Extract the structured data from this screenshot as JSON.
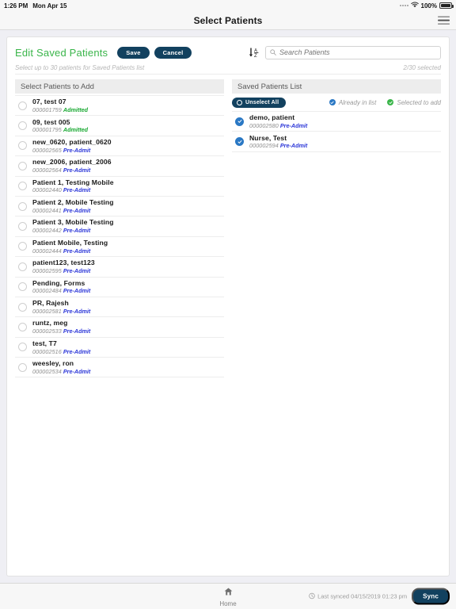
{
  "status_bar": {
    "time": "1:26 PM",
    "date": "Mon Apr 15",
    "wifi_icon": "wifi-icon",
    "battery_percent": "100%",
    "battery_icon": "battery-full-icon"
  },
  "navbar": {
    "title": "Select Patients",
    "menu_icon": "hamburger-menu-icon"
  },
  "toolbar": {
    "title": "Edit Saved Patients",
    "title_color": "#3ab54a",
    "save_label": "Save",
    "cancel_label": "Cancel",
    "sort_icon": "sort-alpha-ascending-icon",
    "search_icon": "search-icon",
    "search_placeholder": "Search Patients",
    "search_value": ""
  },
  "subline": {
    "hint": "Select up to 30 patients for Saved Patients list",
    "counter": "2/30 selected"
  },
  "left_panel": {
    "header": "Select Patients to Add",
    "patients": [
      {
        "name": "07, test 07",
        "mrn": "000001759",
        "status": "Admitted",
        "status_type": "admitted",
        "selected": false
      },
      {
        "name": "09, test 005",
        "mrn": "000001795",
        "status": "Admitted",
        "status_type": "admitted",
        "selected": false
      },
      {
        "name": "new_0620, patient_0620",
        "mrn": "000002565",
        "status": "Pre-Admit",
        "status_type": "preadmit",
        "selected": false
      },
      {
        "name": "new_2006, patient_2006",
        "mrn": "000002564",
        "status": "Pre-Admit",
        "status_type": "preadmit",
        "selected": false
      },
      {
        "name": "Patient 1, Testing Mobile",
        "mrn": "000002440",
        "status": "Pre-Admit",
        "status_type": "preadmit",
        "selected": false
      },
      {
        "name": "Patient 2, Mobile Testing",
        "mrn": "000002441",
        "status": "Pre-Admit",
        "status_type": "preadmit",
        "selected": false
      },
      {
        "name": "Patient 3, Mobile Testing",
        "mrn": "000002442",
        "status": "Pre-Admit",
        "status_type": "preadmit",
        "selected": false
      },
      {
        "name": "Patient Mobile, Testing",
        "mrn": "000002444",
        "status": "Pre-Admit",
        "status_type": "preadmit",
        "selected": false
      },
      {
        "name": "patient123, test123",
        "mrn": "000002595",
        "status": "Pre-Admit",
        "status_type": "preadmit",
        "selected": false
      },
      {
        "name": "Pending, Forms",
        "mrn": "000002484",
        "status": "Pre-Admit",
        "status_type": "preadmit",
        "selected": false
      },
      {
        "name": "PR, Rajesh",
        "mrn": "000002581",
        "status": "Pre-Admit",
        "status_type": "preadmit",
        "selected": false
      },
      {
        "name": "runtz, meg",
        "mrn": "000002533",
        "status": "Pre-Admit",
        "status_type": "preadmit",
        "selected": false
      },
      {
        "name": "test, T7",
        "mrn": "000002516",
        "status": "Pre-Admit",
        "status_type": "preadmit",
        "selected": false
      },
      {
        "name": "weesley, ron",
        "mrn": "000002534",
        "status": "Pre-Admit",
        "status_type": "preadmit",
        "selected": false
      }
    ]
  },
  "right_panel": {
    "header": "Saved Patients List",
    "unselect_all_label": "Unselect All",
    "legend": [
      {
        "label": "Already in list",
        "color": "#2a78c4"
      },
      {
        "label": "Selected to add",
        "color": "#3ab54a"
      }
    ],
    "patients": [
      {
        "name": "demo, patient",
        "mrn": "000002580",
        "status": "Pre-Admit",
        "status_type": "preadmit",
        "selected": true
      },
      {
        "name": "Nurse, Test",
        "mrn": "000002594",
        "status": "Pre-Admit",
        "status_type": "preadmit",
        "selected": true
      }
    ]
  },
  "tabbar": {
    "home_icon": "home-icon",
    "home_label": "Home",
    "clock_icon": "clock-icon",
    "last_synced": "Last synced 04/15/2019 01:23 pm",
    "sync_label": "Sync"
  },
  "colors": {
    "accent_navy": "#12415f",
    "accent_green": "#3ab54a",
    "accent_blue": "#2a78c4",
    "status_admitted": "#18a831",
    "status_preadmit": "#2b36d8"
  }
}
